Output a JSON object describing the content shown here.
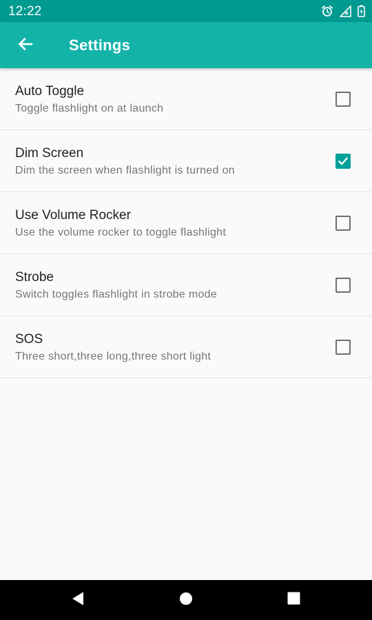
{
  "status_bar": {
    "time": "12:22",
    "icons": [
      "alarm-icon",
      "signal-icon",
      "battery-icon"
    ]
  },
  "app_bar": {
    "title": "Settings",
    "back_icon": "arrow-left-icon"
  },
  "settings": [
    {
      "title": "Auto Toggle",
      "summary": "Toggle flashlight on at launch",
      "checked": false
    },
    {
      "title": "Dim Screen",
      "summary": "Dim the screen when flashlight is turned on",
      "checked": true
    },
    {
      "title": "Use Volume Rocker",
      "summary": "Use the volume rocker to toggle flashlight",
      "checked": false
    },
    {
      "title": "Strobe",
      "summary": "Switch toggles flashlight in strobe mode",
      "checked": false
    },
    {
      "title": "SOS",
      "summary": "Three short,three long,three short light",
      "checked": false
    }
  ],
  "nav_bar": {
    "icons": [
      "back-triangle-icon",
      "home-circle-icon",
      "recents-square-icon"
    ]
  },
  "colors": {
    "status_bar": "#009a91",
    "app_bar": "#13b3a8",
    "accent": "#00a19a",
    "background": "#fafafa"
  }
}
